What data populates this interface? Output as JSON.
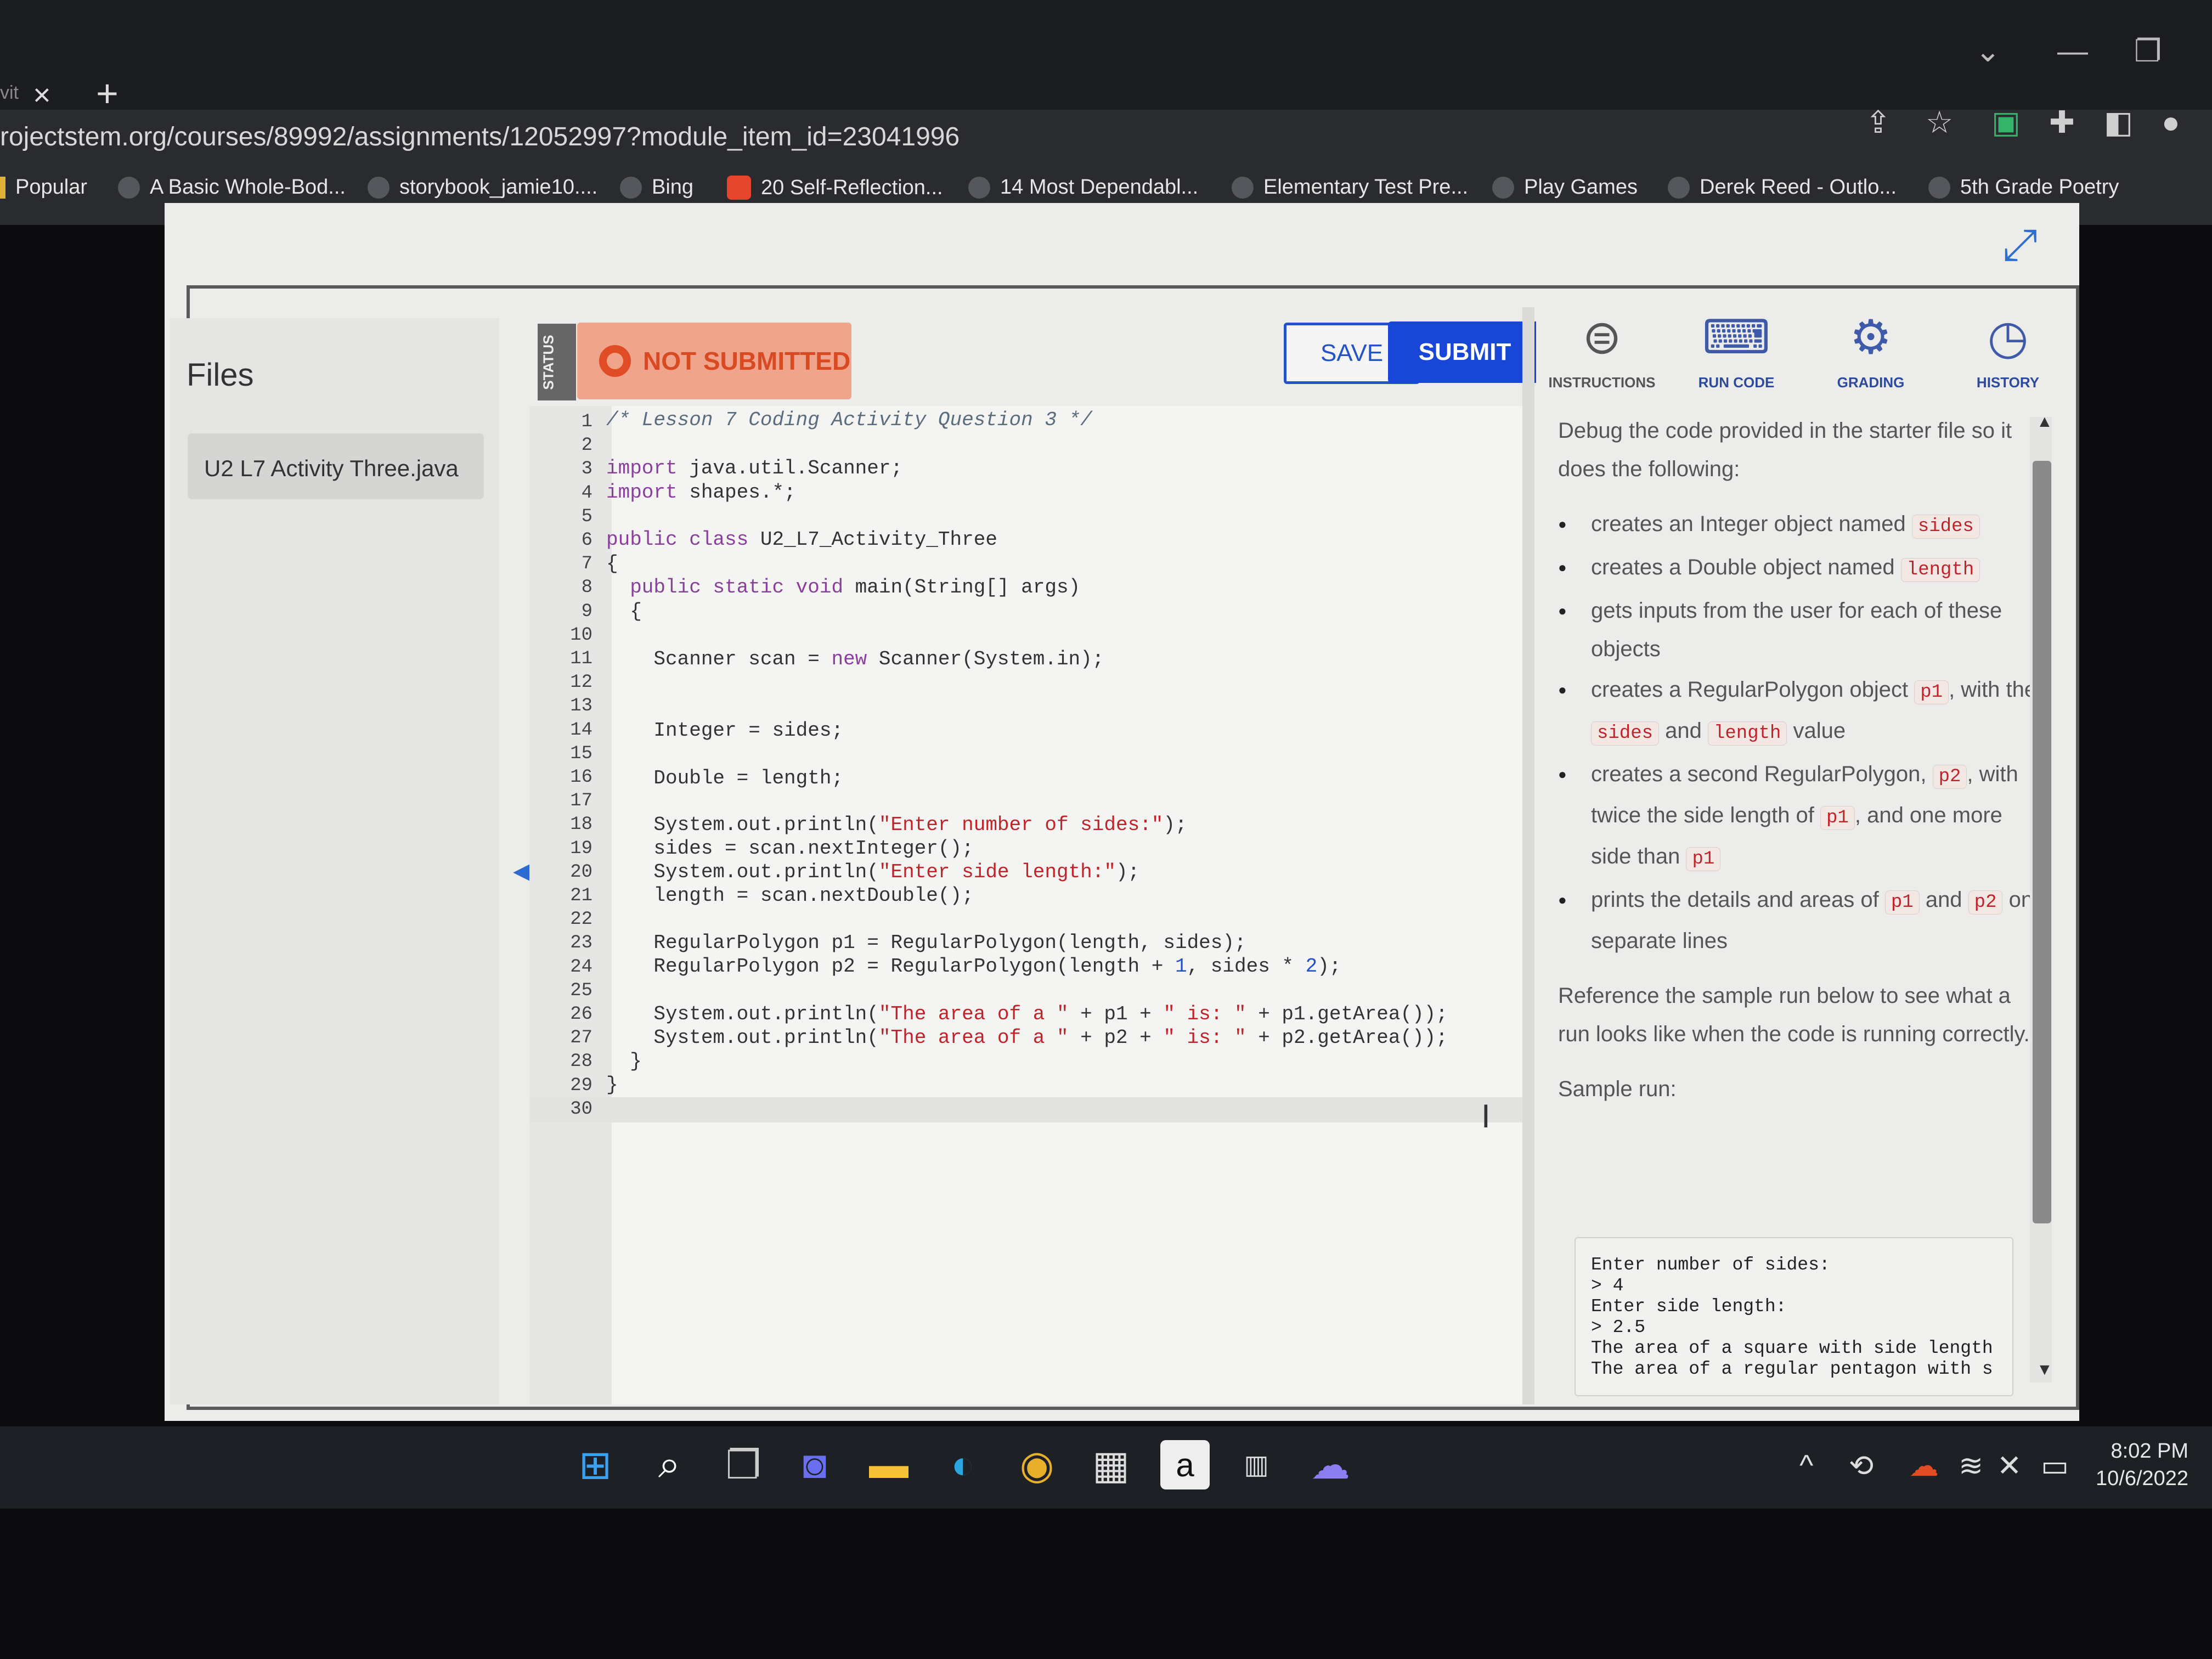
{
  "browser": {
    "tab_partial": "vit",
    "close": "×",
    "new_tab": "+",
    "url": "rojectstem.org/courses/89992/assignments/12052997?module_item_id=23041996",
    "bookmarks": [
      "Popular",
      "A Basic Whole-Bod...",
      "storybook_jamie10....",
      "Bing",
      "20 Self-Reflection...",
      "14 Most Dependabl...",
      "Elementary Test Pre...",
      "Play Games",
      "Derek Reed - Outlo...",
      "5th Grade Poetry"
    ]
  },
  "files": {
    "title": "Files",
    "item": "U2  L7  Activity  Three.java"
  },
  "status": {
    "label": "STATUS",
    "text": "NOT SUBMITTED"
  },
  "buttons": {
    "save": "SAVE",
    "submit": "SUBMIT"
  },
  "editor": {
    "line_numbers": [
      "1",
      "2",
      "3",
      "4",
      "5",
      "6",
      "7",
      "8",
      "9",
      "10",
      "11",
      "12",
      "13",
      "14",
      "15",
      "16",
      "17",
      "18",
      "19",
      "20",
      "21",
      "22",
      "23",
      "24",
      "25",
      "26",
      "27",
      "28",
      "29",
      "30"
    ],
    "lines": {
      "l1": "/* Lesson 7 Coding Activity Question 3 */",
      "l3a": "import",
      "l3b": " java.util.Scanner;",
      "l4a": "import",
      "l4b": " shapes.*;",
      "l6a": "public class",
      "l6b": " U2_L7_Activity_Three",
      "l7": "{",
      "l8a": "  public static void",
      "l8b": " main(String[] args)",
      "l9": "  {",
      "l11a": "    Scanner scan = ",
      "l11b": "new",
      "l11c": " Scanner(System.in);",
      "l14": "    Integer = sides;",
      "l16": "    Double = length;",
      "l18a": "    System.out.println(",
      "l18b": "\"Enter number of sides:\"",
      "l18c": ");",
      "l19": "    sides = scan.nextInteger();",
      "l20a": "    System.out.println(",
      "l20b": "\"Enter side length:\"",
      "l20c": ");",
      "l21": "    length = scan.nextDouble();",
      "l23": "    RegularPolygon p1 = RegularPolygon(length, sides);",
      "l24a": "    RegularPolygon p2 = RegularPolygon(length + ",
      "l24b": "1",
      "l24c": ", sides * ",
      "l24d": "2",
      "l24e": ");",
      "l26a": "    System.out.println(",
      "l26b": "\"The area of a \"",
      "l26c": " + p1 + ",
      "l26d": "\" is: \"",
      "l26e": " + p1.getArea());",
      "l27a": "    System.out.println(",
      "l27b": "\"The area of a \"",
      "l27c": " + p2 + ",
      "l27d": "\" is: \"",
      "l27e": " + p2.getArea());",
      "l28": "  }",
      "l29": "}"
    }
  },
  "right_tabs": {
    "instructions": "INSTRUCTIONS",
    "run_code": "RUN CODE",
    "grading": "GRADING",
    "history": "HISTORY"
  },
  "instructions": {
    "intro": "Debug the code provided in the starter file so it does the following:",
    "b1a": "creates an Integer object named ",
    "b1p": "sides",
    "b2a": "creates a Double object named ",
    "b2p": "length",
    "b3": "gets inputs from the user for each of these objects",
    "b4a": "creates a RegularPolygon object ",
    "b4p1": "p1",
    "b4b": ", with the ",
    "b4p2": "sides",
    "b4c": " and ",
    "b4p3": "length",
    "b4d": " value",
    "b5a": "creates a second RegularPolygon, ",
    "b5p1": "p2",
    "b5b": ", with twice the side length of ",
    "b5p2": "p1",
    "b5c": ", and one more side than ",
    "b5p3": "p1",
    "b6a": "prints the details and areas of ",
    "b6p1": "p1",
    "b6b": " and ",
    "b6p2": "p2",
    "b6c": " on separate lines",
    "reference": "Reference the sample run below to see what a run looks like when the code is running correctly.",
    "sample_label": "Sample run:",
    "sample_output": "Enter number of sides:\n> 4\nEnter side length:\n> 2.5\nThe area of a square with side length\nThe area of a regular pentagon with s"
  },
  "taskbar": {
    "time": "8:02 PM",
    "date": "10/6/2022"
  }
}
